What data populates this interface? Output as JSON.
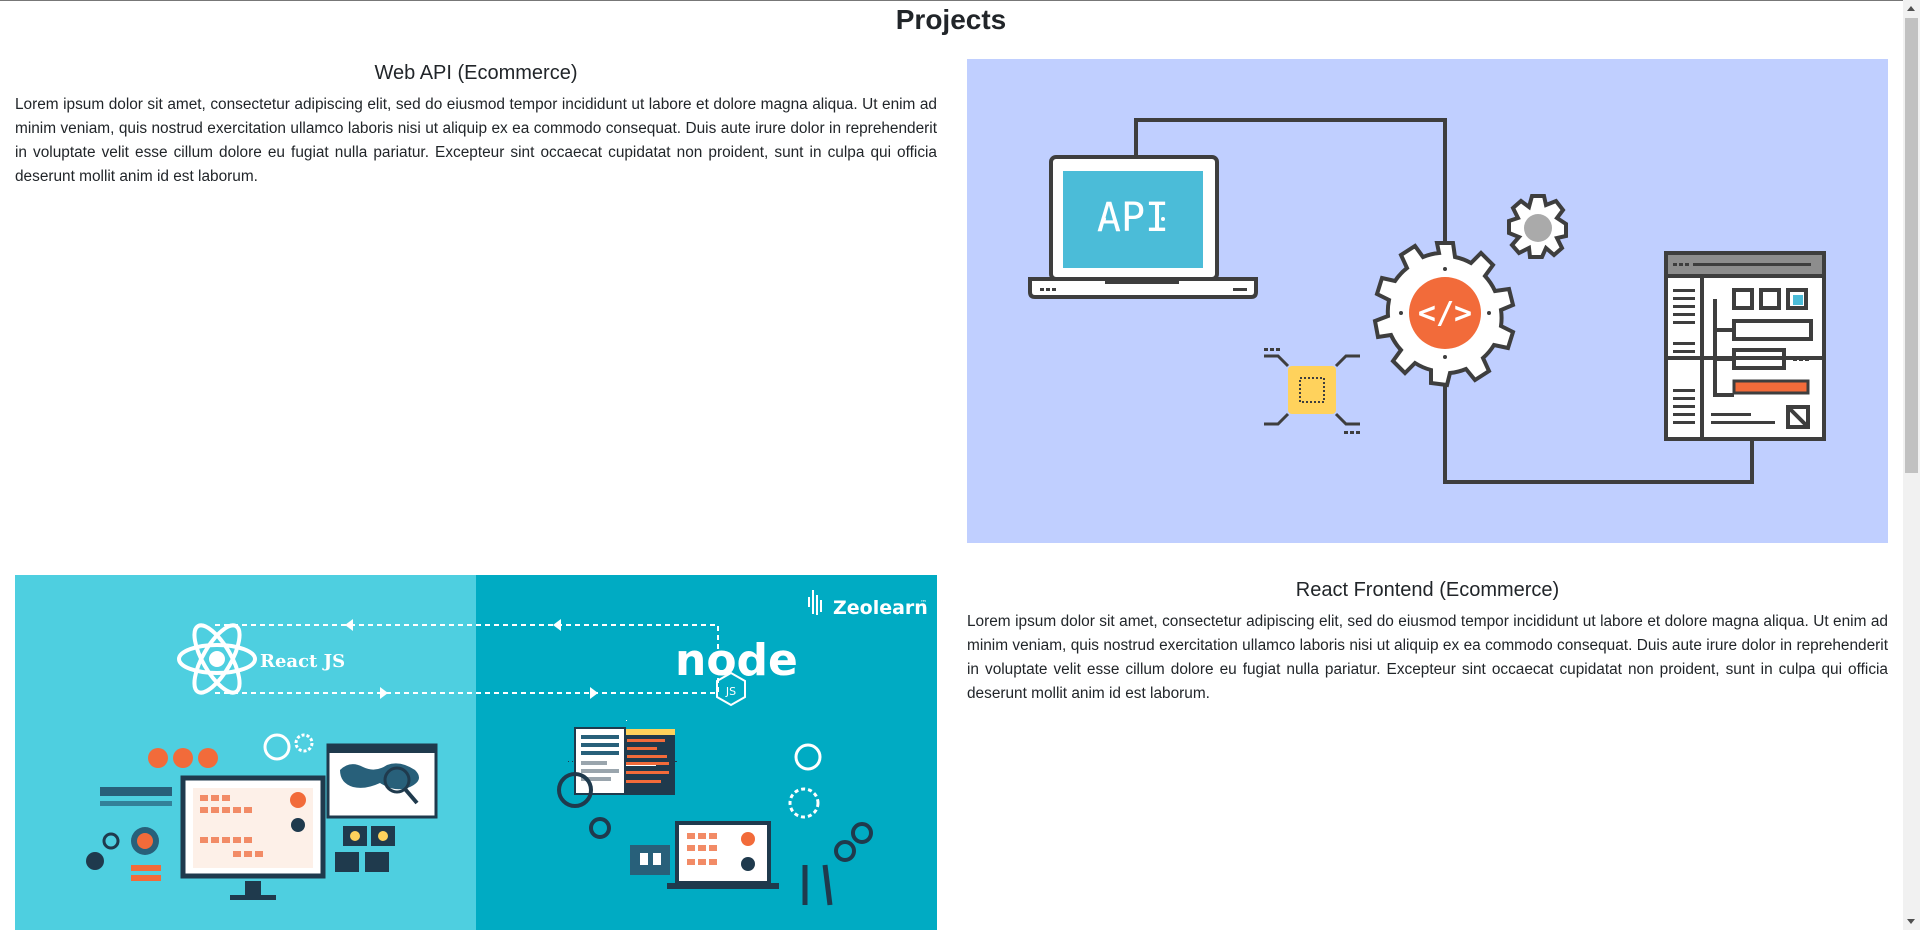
{
  "page": {
    "title": "Projects"
  },
  "projects": [
    {
      "title": "Web API (Ecommerce)",
      "description": "Lorem ipsum dolor sit amet, consectetur adipiscing elit, sed do eiusmod tempor incididunt ut labore et dolore magna aliqua. Ut enim ad minim veniam, quis nostrud exercitation ullamco laboris nisi ut aliquip ex ea commodo consequat. Duis aute irure dolor in reprehenderit in voluptate velit esse cillum dolore eu fugiat nulla pariatur. Excepteur sint occaecat cupidatat non proident, sunt in culpa qui officia deserunt mollit anim id est laborum.",
      "image": {
        "api_label": "API",
        "code_symbol": "</>"
      }
    },
    {
      "title": "React Frontend (Ecommerce)",
      "description": "Lorem ipsum dolor sit amet, consectetur adipiscing elit, sed do eiusmod tempor incididunt ut labore et dolore magna aliqua. Ut enim ad minim veniam, quis nostrud exercitation ullamco laboris nisi ut aliquip ex ea commodo consequat. Duis aute irure dolor in reprehenderit in voluptate velit esse cillum dolore eu fugiat nulla pariatur. Excepteur sint occaecat cupidatat non proident, sunt in culpa qui officia deserunt mollit anim id est laborum.",
      "image": {
        "react_label": "React JS",
        "node_label": "node",
        "js_label": "JS",
        "brand": "Zeolearn",
        "brand_tm": "™"
      }
    }
  ],
  "colors": {
    "api_bg": "#c0cfff",
    "react_bg": "#4ecfe0",
    "node_bg": "#00abc3",
    "orange": "#f26b3a",
    "api_screen": "#4bbcd8",
    "chip": "#ffd25c"
  }
}
